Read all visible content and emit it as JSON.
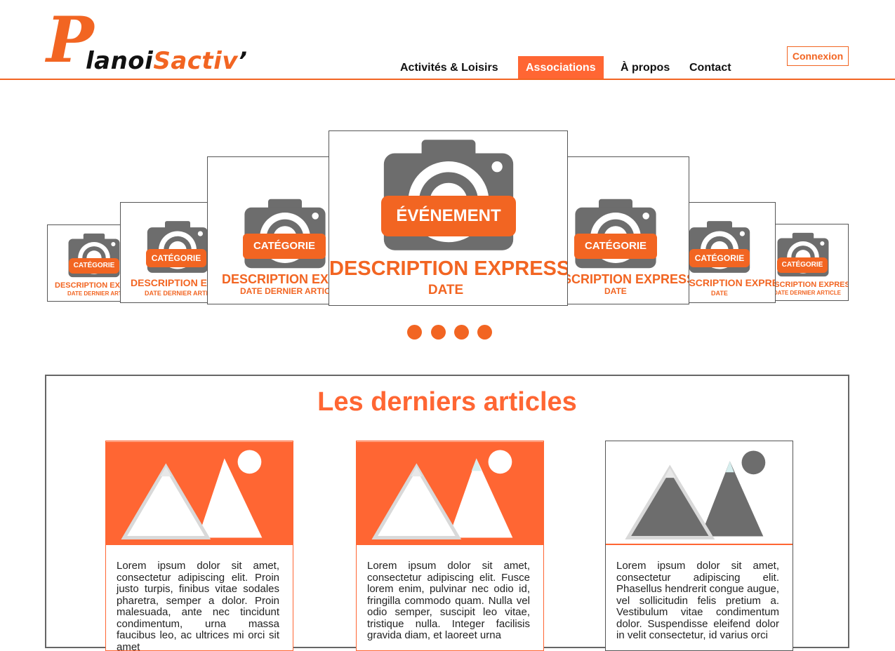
{
  "brand": {
    "logo_initial": "P",
    "logo_part1": "lanoi",
    "logo_part2": "Sactiv",
    "logo_apostrophe": "’"
  },
  "nav": {
    "items": [
      {
        "label": "Activités & Loisirs",
        "active": false
      },
      {
        "label": "Associations",
        "active": true
      },
      {
        "label": "À propos",
        "active": false
      },
      {
        "label": "Contact",
        "active": false
      }
    ],
    "login_label": "Connexion"
  },
  "carousel": {
    "center": {
      "badge": "ÉVÉNEMENT",
      "description": "DESCRIPTION EXPRESS",
      "date": "DATE"
    },
    "cards": [
      {
        "badge": "CATÉGORIE",
        "description": "DESCRIPTION EXPRESS",
        "date": "DATE DERNIER ARTICLE"
      },
      {
        "badge": "CATÉGORIE",
        "description": "DESCRIPTION EXPRESS",
        "date": "DATE DERNIER ARTICLE"
      },
      {
        "badge": "CATÉGORIE",
        "description": "DESCRIPTION EXPRESS",
        "date": "DATE DERNIER ARTICLE"
      },
      {
        "badge": "CATÉGORIE",
        "description": "DESCRIPTION EXPRESS",
        "date": "DATE"
      },
      {
        "badge": "CATÉGORIE",
        "description": "DESCRIPTION EXPRESS",
        "date": "DATE"
      },
      {
        "badge": "CATÉGORIE",
        "description": "DESCRIPTION EXPRESS",
        "date": "DATE DERNIER ARTICLE"
      }
    ],
    "dots_count": 4
  },
  "articles": {
    "title": "Les derniers articles",
    "items": [
      {
        "text": "Lorem ipsum dolor sit amet, consectetur adipiscing elit. Proin justo turpis, finibus vitae sodales pharetra, semper a dolor. Proin malesuada, ante nec tincidunt condimentum, urna massa faucibus leo, ac ultrices mi orci sit amet"
      },
      {
        "text": "Lorem ipsum dolor sit amet, consectetur adipiscing elit. Fusce lorem enim, pulvinar nec odio id, fringilla commodo quam. Nulla vel odio semper, suscipit leo vitae, tristique nulla. Integer facilisis gravida diam, et laoreet urna"
      },
      {
        "text": "Lorem ipsum dolor sit amet, consectetur adipiscing elit. Phasellus hendrerit congue augue, vel sollicitudin felis pretium a. Vestibulum vitae condimentum dolor. Suspendisse eleifend dolor in velit consectetur, id varius orci"
      }
    ]
  },
  "colors": {
    "accent": "#f26522",
    "accent_light": "#ff6633",
    "icon_gray": "#6d6d6d"
  }
}
